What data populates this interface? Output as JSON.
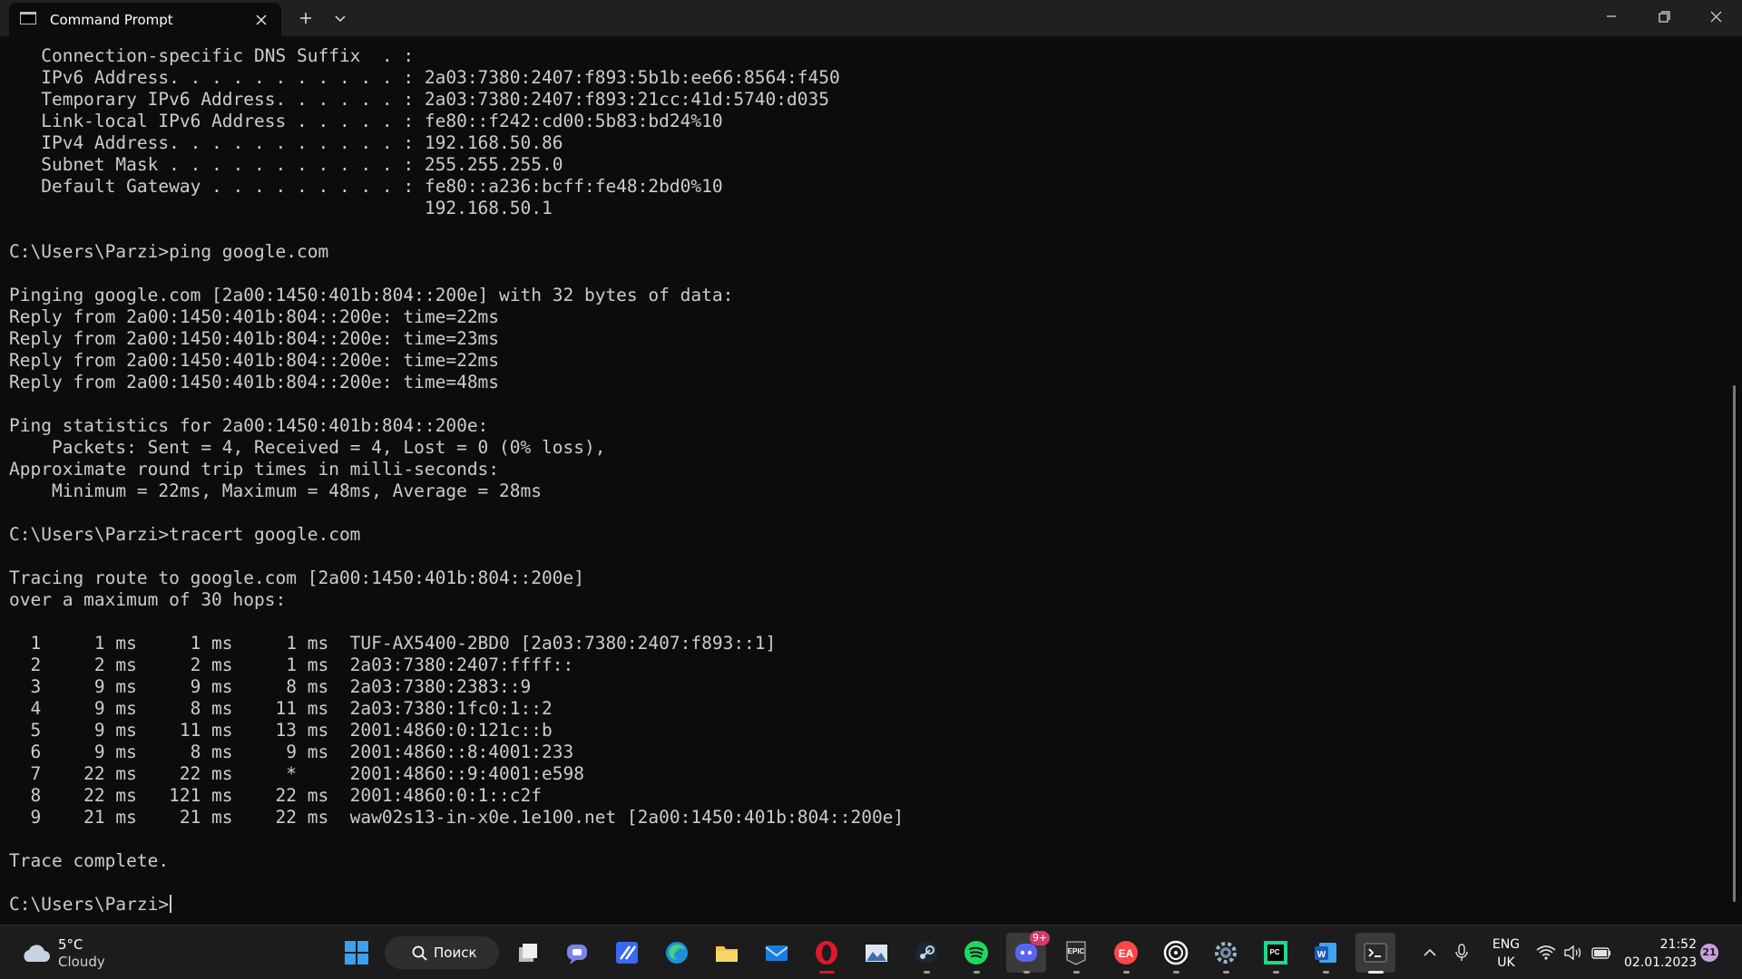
{
  "window": {
    "tab_title": "Command Prompt"
  },
  "console": {
    "lines": [
      "   Connection-specific DNS Suffix  . :",
      "   IPv6 Address. . . . . . . . . . . : 2a03:7380:2407:f893:5b1b:ee66:8564:f450",
      "   Temporary IPv6 Address. . . . . . : 2a03:7380:2407:f893:21cc:41d:5740:d035",
      "   Link-local IPv6 Address . . . . . : fe80::f242:cd00:5b83:bd24%10",
      "   IPv4 Address. . . . . . . . . . . : 192.168.50.86",
      "   Subnet Mask . . . . . . . . . . . : 255.255.255.0",
      "   Default Gateway . . . . . . . . . : fe80::a236:bcff:fe48:2bd0%10",
      "                                       192.168.50.1",
      "",
      "C:\\Users\\Parzi>ping google.com",
      "",
      "Pinging google.com [2a00:1450:401b:804::200e] with 32 bytes of data:",
      "Reply from 2a00:1450:401b:804::200e: time=22ms",
      "Reply from 2a00:1450:401b:804::200e: time=23ms",
      "Reply from 2a00:1450:401b:804::200e: time=22ms",
      "Reply from 2a00:1450:401b:804::200e: time=48ms",
      "",
      "Ping statistics for 2a00:1450:401b:804::200e:",
      "    Packets: Sent = 4, Received = 4, Lost = 0 (0% loss),",
      "Approximate round trip times in milli-seconds:",
      "    Minimum = 22ms, Maximum = 48ms, Average = 28ms",
      "",
      "C:\\Users\\Parzi>tracert google.com",
      "",
      "Tracing route to google.com [2a00:1450:401b:804::200e]",
      "over a maximum of 30 hops:",
      "",
      "  1     1 ms     1 ms     1 ms  TUF-AX5400-2BD0 [2a03:7380:2407:f893::1]",
      "  2     2 ms     2 ms     1 ms  2a03:7380:2407:ffff::",
      "  3     9 ms     9 ms     8 ms  2a03:7380:2383::9",
      "  4     9 ms     8 ms    11 ms  2a03:7380:1fc0:1::2",
      "  5     9 ms    11 ms    13 ms  2001:4860:0:121c::b",
      "  6     9 ms     8 ms     9 ms  2001:4860::8:4001:233",
      "  7    22 ms    22 ms     *     2001:4860::9:4001:e598",
      "  8    22 ms   121 ms    22 ms  2001:4860:0:1::c2f",
      "  9    21 ms    21 ms    22 ms  waw02s13-in-x0e.1e100.net [2a00:1450:401b:804::200e]",
      "",
      "Trace complete.",
      ""
    ],
    "prompt": "C:\\Users\\Parzi>"
  },
  "taskbar": {
    "weather": {
      "temp": "5°C",
      "condition": "Cloudy",
      "icon": "cloud-icon"
    },
    "search_label": "Поиск",
    "apps": [
      {
        "name": "start-button",
        "icon": "windows-logo-icon"
      },
      {
        "name": "task-view",
        "icon": "task-view-icon"
      },
      {
        "name": "teams-chat",
        "icon": "chat-icon"
      },
      {
        "name": "app-blue",
        "icon": "app-blue-icon"
      },
      {
        "name": "edge",
        "icon": "edge-icon"
      },
      {
        "name": "file-explorer",
        "icon": "folder-icon"
      },
      {
        "name": "mail",
        "icon": "mail-icon"
      },
      {
        "name": "opera",
        "icon": "opera-icon"
      },
      {
        "name": "photos",
        "icon": "photos-icon"
      },
      {
        "name": "steam",
        "icon": "steam-icon"
      },
      {
        "name": "spotify",
        "icon": "spotify-icon"
      },
      {
        "name": "discord",
        "icon": "discord-icon",
        "badge": "9+"
      },
      {
        "name": "epic-games",
        "icon": "epic-games-icon",
        "label": "EPIC"
      },
      {
        "name": "ea",
        "icon": "ea-icon",
        "label": "EA"
      },
      {
        "name": "ubisoft",
        "icon": "ubisoft-icon"
      },
      {
        "name": "settings",
        "icon": "gear-icon"
      },
      {
        "name": "pycharm",
        "icon": "pycharm-icon",
        "label": "PC"
      },
      {
        "name": "word",
        "icon": "word-icon",
        "label": "W"
      },
      {
        "name": "terminal",
        "icon": "terminal-icon"
      }
    ],
    "language": {
      "line1": "ENG",
      "line2": "UK"
    },
    "clock": {
      "time": "21:52",
      "date": "02.01.2023"
    },
    "notification_count": "21"
  }
}
